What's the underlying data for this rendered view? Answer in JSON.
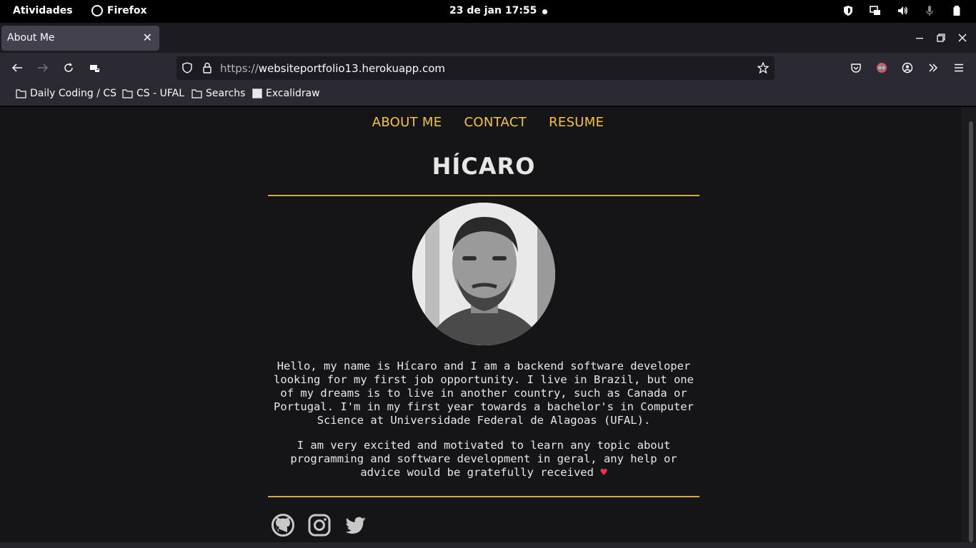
{
  "system_bar": {
    "activities": "Atividades",
    "app_name": "Firefox",
    "clock": "23 de jan  17:55"
  },
  "browser": {
    "tab_title": "About Me",
    "url_protocol": "https://",
    "url_host": "websiteportfolio13.herokuapp.com",
    "bookmarks": [
      "Daily Coding / CS",
      "CS - UFAL",
      "Searchs",
      "Excalidraw"
    ]
  },
  "page": {
    "nav": [
      "ABOUT ME",
      "CONTACT",
      "RESUME"
    ],
    "name": "HÍCARO",
    "bio_paragraph_1": "Hello, my name is Hícaro and I am a backend software developer looking for my first job opportunity. I live in Brazil, but one of my dreams is to live in another country, such as Canada or Portugal. I'm in my first year towards a bachelor's in Computer Science at Universidade Federal de Alagoas (UFAL).",
    "bio_paragraph_2": "I am very excited and motivated to learn any topic about programming and software development in geral, any help or advice would be gratefully received",
    "heart_glyph": "♥",
    "social_icons": [
      "github-icon",
      "instagram-icon",
      "twitter-icon"
    ]
  },
  "colors": {
    "accent": "#f2c43f",
    "page_bg": "#151517",
    "rule": "#d9a93c"
  }
}
